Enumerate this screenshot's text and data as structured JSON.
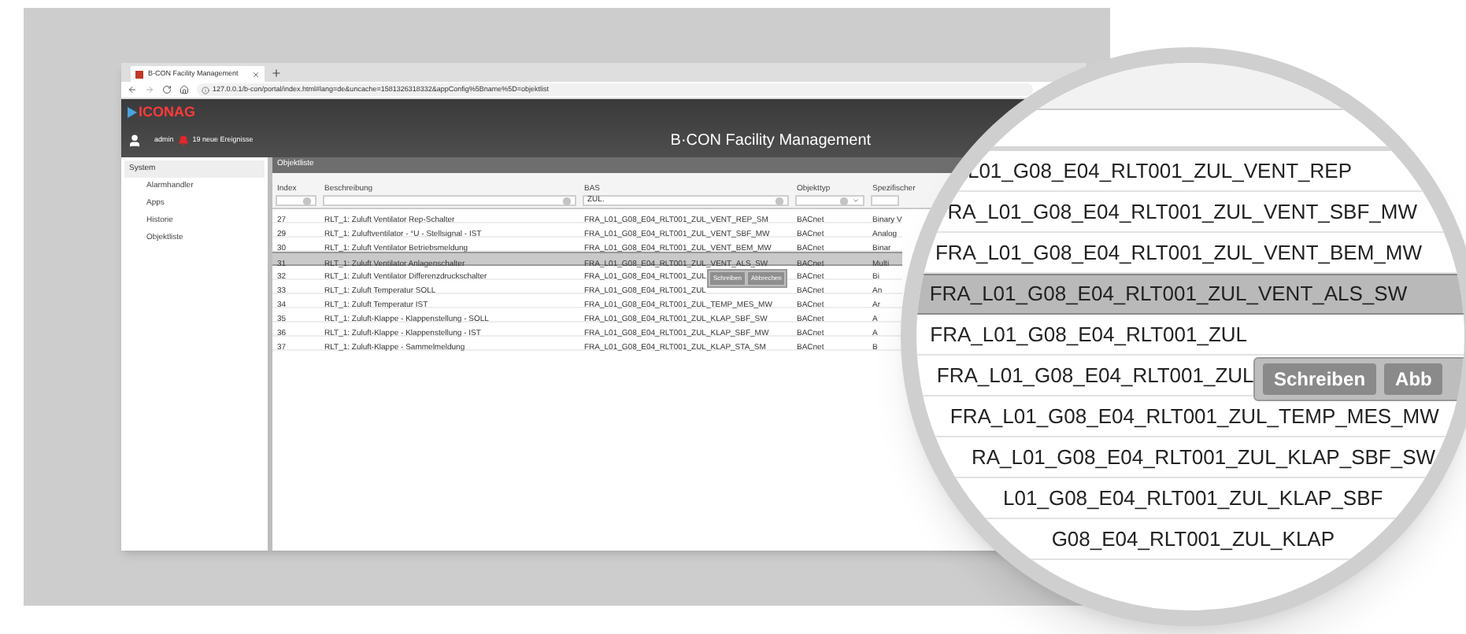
{
  "browser": {
    "tab_title": "B-CON Facility Management",
    "url": "127.0.0.1/b-con/portal/index.html#lang=de&uncache=1581326318332&appConfig%5Bname%5D=objektlist"
  },
  "app_header": {
    "logo": "ICONAG",
    "user": "admin",
    "events": "19 neue Ereignisse",
    "title": "B·CON Facility Management"
  },
  "sidebar": {
    "heading": "System",
    "items": [
      "Alarmhandler",
      "Apps",
      "Historie",
      "Objektliste"
    ]
  },
  "panel": {
    "title": "Objektliste",
    "columns": [
      "Index",
      "Beschreibung",
      "BAS",
      "Objekttyp",
      "Spezifischer"
    ],
    "filters": [
      {
        "kind": "text"
      },
      {
        "kind": "text"
      },
      {
        "kind": "text",
        "value": "ZUL."
      },
      {
        "kind": "select"
      },
      {
        "kind": "plain"
      }
    ],
    "rows": [
      {
        "selected": false,
        "cells": [
          "27",
          "RLT_1: Zuluft Ventilator Rep-Schalter",
          "FRA_L01_G08_E04_RLT001_ZUL_VENT_REP_SM",
          "BACnet",
          "Binary V"
        ]
      },
      {
        "selected": false,
        "cells": [
          "29",
          "RLT_1: Zuluftventilator - °U - Stellsignal - IST",
          "FRA_L01_G08_E04_RLT001_ZUL_VENT_SBF_MW",
          "BACnet",
          "Analog"
        ]
      },
      {
        "selected": false,
        "cells": [
          "30",
          "RLT_1: Zuluft Ventilator Betriebsmeldung",
          "FRA_L01_G08_E04_RLT001_ZUL_VENT_BEM_MW",
          "BACnet",
          "Binar"
        ]
      },
      {
        "selected": true,
        "cells": [
          "31",
          "RLT_1: Zuluft Ventilator Anlagenschalter",
          "FRA_L01_G08_E04_RLT001_ZUL_VENT_ALS_SW",
          "BACnet",
          "Multi"
        ]
      },
      {
        "selected": false,
        "cells": [
          "32",
          "RLT_1: Zuluft Ventilator Differenzdruckschalter",
          "FRA_L01_G08_E04_RLT001_ZUL",
          "BACnet",
          "Bi"
        ]
      },
      {
        "selected": false,
        "cells": [
          "33",
          "RLT_1: Zuluft Temperatur SOLL",
          "FRA_L01_G08_E04_RLT001_ZUL",
          "BACnet",
          "An"
        ]
      },
      {
        "selected": false,
        "cells": [
          "34",
          "RLT_1: Zuluft Temperatur IST",
          "FRA_L01_G08_E04_RLT001_ZUL_TEMP_MES_MW",
          "BACnet",
          "Ar"
        ]
      },
      {
        "selected": false,
        "cells": [
          "35",
          "RLT_1: Zuluft-Klappe - Klappenstellung - SOLL",
          "FRA_L01_G08_E04_RLT001_ZUL_KLAP_SBF_SW",
          "BACnet",
          "A"
        ]
      },
      {
        "selected": false,
        "cells": [
          "36",
          "RLT_1: Zuluft-Klappe - Klappenstellung - IST",
          "FRA_L01_G08_E04_RLT001_ZUL_KLAP_SBF_MW",
          "BACnet",
          "A"
        ]
      },
      {
        "selected": false,
        "cells": [
          "37",
          "RLT_1: Zuluft-Klappe - Sammelmeldung",
          "FRA_L01_G08_E04_RLT001_ZUL_KLAP_STA_SM",
          "BACnet",
          "B"
        ]
      }
    ],
    "popup": {
      "buttons": [
        "Schreiben",
        "Abbrechen"
      ]
    }
  },
  "magnifier": {
    "rows": [
      {
        "selected": false,
        "text": "L01_G08_E04_RLT001_ZUL_VENT_REP"
      },
      {
        "selected": false,
        "text": "RA_L01_G08_E04_RLT001_ZUL_VENT_SBF_MW"
      },
      {
        "selected": false,
        "text": "FRA_L01_G08_E04_RLT001_ZUL_VENT_BEM_MW"
      },
      {
        "selected": true,
        "text": "FRA_L01_G08_E04_RLT001_ZUL_VENT_ALS_SW"
      },
      {
        "selected": false,
        "text": "FRA_L01_G08_E04_RLT001_ZUL"
      },
      {
        "selected": false,
        "text": "FRA_L01_G08_E04_RLT001_ZUL"
      },
      {
        "selected": false,
        "text": "FRA_L01_G08_E04_RLT001_ZUL_TEMP_MES_MW"
      },
      {
        "selected": false,
        "text": "RA_L01_G08_E04_RLT001_ZUL_KLAP_SBF_SW"
      },
      {
        "selected": false,
        "text": "L01_G08_E04_RLT001_ZUL_KLAP_SBF"
      },
      {
        "selected": false,
        "text": "G08_E04_RLT001_ZUL_KLAP"
      }
    ],
    "buttons": [
      "Schreiben",
      "Abb"
    ]
  }
}
